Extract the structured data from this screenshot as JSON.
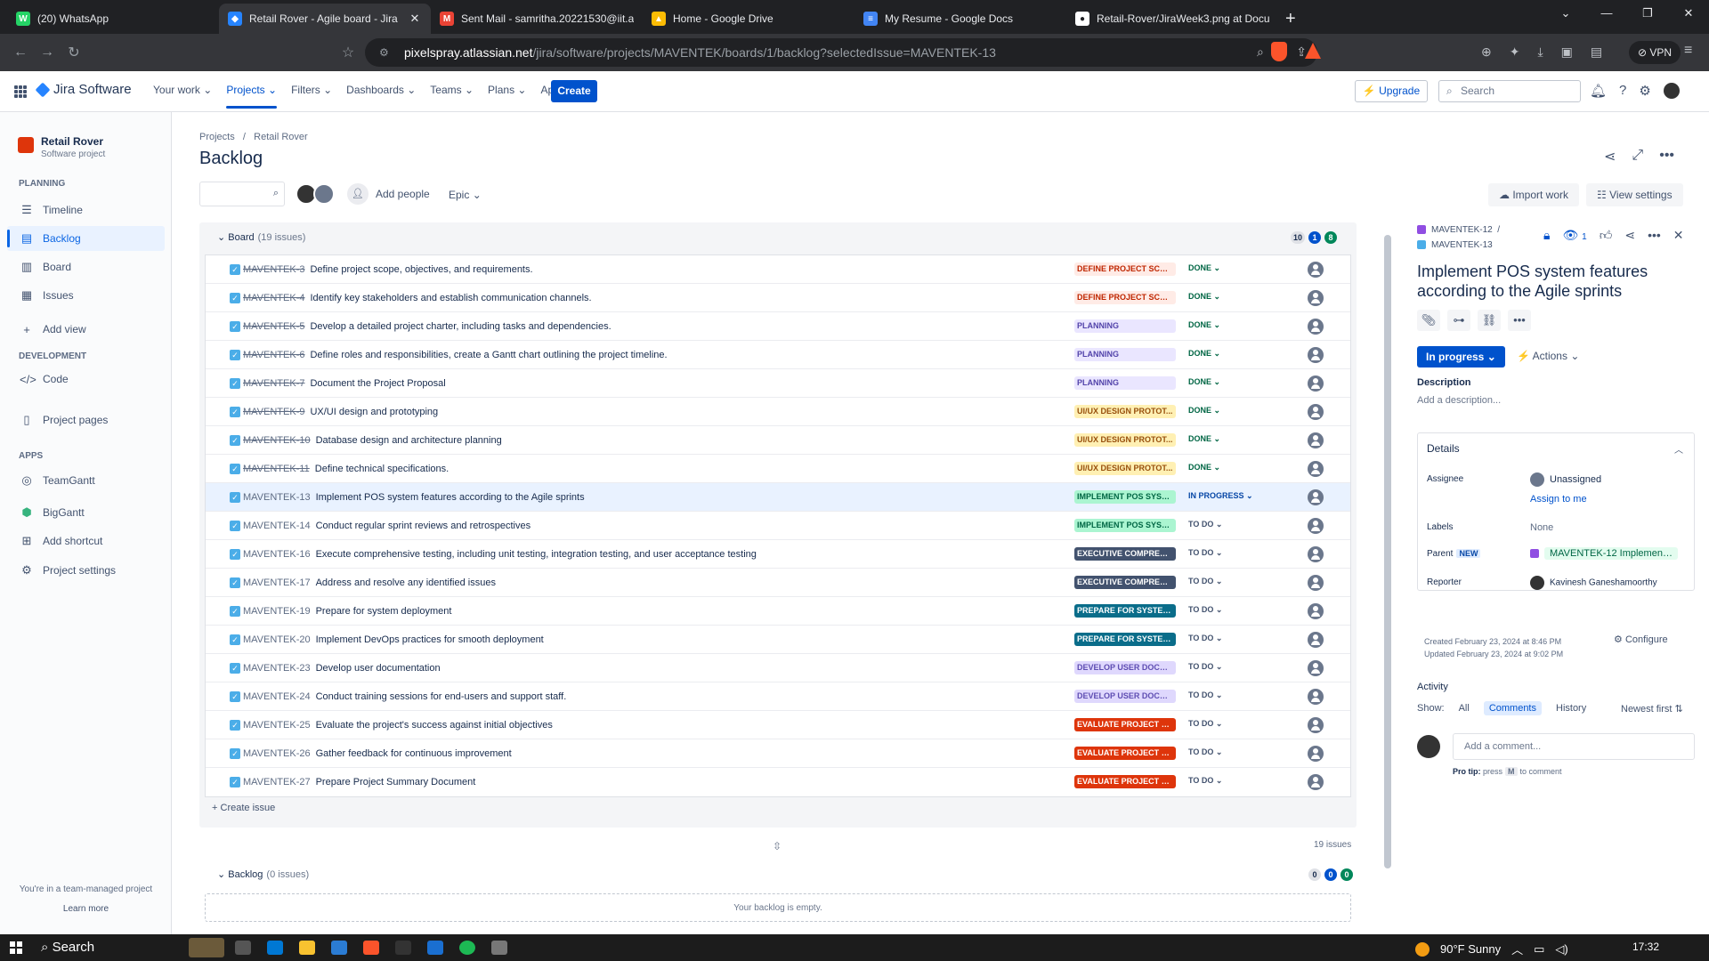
{
  "browser": {
    "tabs": [
      {
        "label": "(20) WhatsApp",
        "icon": "whatsapp-icon",
        "color": "#25d366",
        "glyph": "W",
        "active": false,
        "closable": false
      },
      {
        "label": "Retail Rover - Agile board - Jira",
        "icon": "jira-icon",
        "color": "#2684ff",
        "glyph": "◆",
        "active": true,
        "closable": true
      },
      {
        "label": "Sent Mail - samritha.20221530@iit.ac",
        "icon": "gmail-icon",
        "color": "#ea4335",
        "glyph": "M",
        "active": false,
        "closable": false
      },
      {
        "label": "Home - Google Drive",
        "icon": "google-drive-icon",
        "color": "#fbbc04",
        "glyph": "▲",
        "active": false,
        "closable": false
      },
      {
        "label": "My Resume - Google Docs",
        "icon": "google-docs-icon",
        "color": "#4285f4",
        "glyph": "≡",
        "active": false,
        "closable": false
      },
      {
        "label": "Retail-Rover/JiraWeek3.png at Docum",
        "icon": "github-icon",
        "color": "#ffffff",
        "glyph": "●",
        "active": false,
        "closable": false
      }
    ],
    "url_host": "pixelspray.atlassian.net",
    "url_path": "/jira/software/projects/MAVENTEK/boards/1/backlog?selectedIssue=MAVENTEK-13",
    "vpn_label": "VPN",
    "brave_badge": "3"
  },
  "jira_nav": {
    "product": "Jira Software",
    "items": [
      "Your work",
      "Projects",
      "Filters",
      "Dashboards",
      "Teams",
      "Plans",
      "Apps"
    ],
    "selected": "Projects",
    "create": "Create",
    "upgrade": "Upgrade",
    "search_placeholder": "Search"
  },
  "sidebar": {
    "project_name": "Retail Rover",
    "project_type": "Software project",
    "planning_heading": "PLANNING",
    "planning_items": [
      "Timeline",
      "Backlog",
      "Board",
      "Issues",
      "Add view"
    ],
    "development_heading": "DEVELOPMENT",
    "code": "Code",
    "project_pages": "Project pages",
    "apps_heading": "APPS",
    "apps": [
      "TeamGantt",
      "BigGantt",
      "Add shortcut",
      "Project settings"
    ],
    "footer_text": "You're in a team-managed project",
    "learn_more": "Learn more"
  },
  "page": {
    "breadcrumb_root": "Projects",
    "breadcrumb_sep": "/",
    "breadcrumb_project": "Retail Rover",
    "title": "Backlog",
    "add_people": "Add people",
    "epic_filter": "Epic",
    "import_work": "Import work",
    "view_settings": "View settings"
  },
  "board": {
    "name": "Board",
    "issue_count": "(19 issues)",
    "counts": [
      "10",
      "1",
      "8"
    ],
    "create_issue": "Create issue",
    "total_label": "19 issues",
    "issues": [
      {
        "key": "MAVENTEK-3",
        "summary": "Define project scope, objectives, and requirements.",
        "epic": "DEFINE PROJECT SCOPE...",
        "epic_style": "red-light",
        "status": "DONE",
        "done": true
      },
      {
        "key": "MAVENTEK-4",
        "summary": "Identify key stakeholders and establish communication channels.",
        "epic": "DEFINE PROJECT SCOPE...",
        "epic_style": "red-light",
        "status": "DONE",
        "done": true
      },
      {
        "key": "MAVENTEK-5",
        "summary": "Develop a detailed project charter, including tasks and dependencies.",
        "epic": "PLANNING",
        "epic_style": "purple-light",
        "status": "DONE",
        "done": true
      },
      {
        "key": "MAVENTEK-6",
        "summary": "Define roles and responsibilities, create a Gantt chart outlining the project timeline.",
        "epic": "PLANNING",
        "epic_style": "purple-light",
        "status": "DONE",
        "done": true
      },
      {
        "key": "MAVENTEK-7",
        "summary": "Document the Project Proposal",
        "epic": "PLANNING",
        "epic_style": "purple-light",
        "status": "DONE",
        "done": true
      },
      {
        "key": "MAVENTEK-9",
        "summary": "UX/UI design and prototyping",
        "epic": "UI/UX DESIGN PROTOT...",
        "epic_style": "yellow",
        "status": "DONE",
        "done": true
      },
      {
        "key": "MAVENTEK-10",
        "summary": "Database design and architecture planning",
        "epic": "UI/UX DESIGN PROTOT...",
        "epic_style": "yellow",
        "status": "DONE",
        "done": true
      },
      {
        "key": "MAVENTEK-11",
        "summary": "Define technical specifications.",
        "epic": "UI/UX DESIGN PROTOT...",
        "epic_style": "yellow",
        "status": "DONE",
        "done": true
      },
      {
        "key": "MAVENTEK-13",
        "summary": "Implement POS system features according to the Agile sprints",
        "epic": "IMPLEMENT POS SYSTE...",
        "epic_style": "green",
        "status": "IN PROGRESS",
        "done": false,
        "selected": true
      },
      {
        "key": "MAVENTEK-14",
        "summary": "Conduct regular sprint reviews and retrospectives",
        "epic": "IMPLEMENT POS SYSTE...",
        "epic_style": "green",
        "status": "TO DO",
        "done": false
      },
      {
        "key": "MAVENTEK-16",
        "summary": "Execute comprehensive testing, including unit testing, integration testing, and user acceptance testing",
        "epic": "EXECUTIVE COMPREHE...",
        "epic_style": "dark",
        "status": "TO DO",
        "done": false
      },
      {
        "key": "MAVENTEK-17",
        "summary": "Address and resolve any identified issues",
        "epic": "EXECUTIVE COMPREHE...",
        "epic_style": "dark",
        "status": "TO DO",
        "done": false
      },
      {
        "key": "MAVENTEK-19",
        "summary": "Prepare for system deployment",
        "epic": "PREPARE FOR SYSTEM ...",
        "epic_style": "teal",
        "status": "TO DO",
        "done": false
      },
      {
        "key": "MAVENTEK-20",
        "summary": "Implement DevOps practices for smooth deployment",
        "epic": "PREPARE FOR SYSTEM ...",
        "epic_style": "teal",
        "status": "TO DO",
        "done": false
      },
      {
        "key": "MAVENTEK-23",
        "summary": "Develop user documentation",
        "epic": "DEVELOP USER DOCUM...",
        "epic_style": "lavender",
        "status": "TO DO",
        "done": false
      },
      {
        "key": "MAVENTEK-24",
        "summary": "Conduct training sessions for end-users and support staff.",
        "epic": "DEVELOP USER DOCUM...",
        "epic_style": "lavender",
        "status": "TO DO",
        "done": false
      },
      {
        "key": "MAVENTEK-25",
        "summary": "Evaluate the project's success against initial objectives",
        "epic": "EVALUATE PROJECT SU...",
        "epic_style": "red",
        "status": "TO DO",
        "done": false
      },
      {
        "key": "MAVENTEK-26",
        "summary": "Gather feedback for continuous improvement",
        "epic": "EVALUATE PROJECT SU...",
        "epic_style": "red",
        "status": "TO DO",
        "done": false
      },
      {
        "key": "MAVENTEK-27",
        "summary": "Prepare Project Summary Document",
        "epic": "EVALUATE PROJECT SU...",
        "epic_style": "red",
        "status": "TO DO",
        "done": false
      }
    ]
  },
  "backlog": {
    "name": "Backlog",
    "issue_count": "(0 issues)",
    "counts": [
      "0",
      "0",
      "0"
    ],
    "empty_text": "Your backlog is empty."
  },
  "detail": {
    "parent_key": "MAVENTEK-12",
    "crumb_sep": "/",
    "issue_key": "MAVENTEK-13",
    "watchers": "1",
    "title": "Implement POS system features according to the Agile sprints",
    "status": "In progress",
    "actions": "Actions",
    "description_label": "Description",
    "description_placeholder": "Add a description...",
    "details_heading": "Details",
    "assignee_label": "Assignee",
    "assignee_value": "Unassigned",
    "assign_to_me": "Assign to me",
    "labels_label": "Labels",
    "labels_value": "None",
    "parent_label": "Parent",
    "new_badge": "NEW",
    "parent_value": "MAVENTEK-12 Implement ...",
    "reporter_label": "Reporter",
    "reporter_value": "Kavinesh Ganeshamoorthy",
    "created": "Created February 23, 2024 at 8:46 PM",
    "updated": "Updated February 23, 2024 at 9:02 PM",
    "configure": "Configure",
    "activity_label": "Activity",
    "show_label": "Show:",
    "filters": [
      "All",
      "Comments",
      "History"
    ],
    "active_filter": "Comments",
    "sort": "Newest first",
    "comment_placeholder": "Add a comment...",
    "protip_prefix": "Pro tip:",
    "protip_press": "press",
    "protip_key": "M",
    "protip_suffix": "to comment"
  },
  "taskbar": {
    "search": "Search",
    "weather": "90°F  Sunny",
    "time": "17:32"
  },
  "colors": {
    "accent": "#0052cc",
    "epic_styles": {
      "red-light": {
        "bg": "#ffebe6",
        "fg": "#bf2600"
      },
      "purple-light": {
        "bg": "#eae6ff",
        "fg": "#5243aa"
      },
      "yellow": {
        "bg": "#fff0b3",
        "fg": "#974f0c"
      },
      "green": {
        "bg": "#abf5d1",
        "fg": "#006644"
      },
      "dark": {
        "bg": "#42526e",
        "fg": "#ffffff"
      },
      "teal": {
        "bg": "#0a6d8a",
        "fg": "#ffffff"
      },
      "lavender": {
        "bg": "#dfd8fd",
        "fg": "#5e4db2"
      },
      "red": {
        "bg": "#de350b",
        "fg": "#ffffff"
      }
    }
  }
}
